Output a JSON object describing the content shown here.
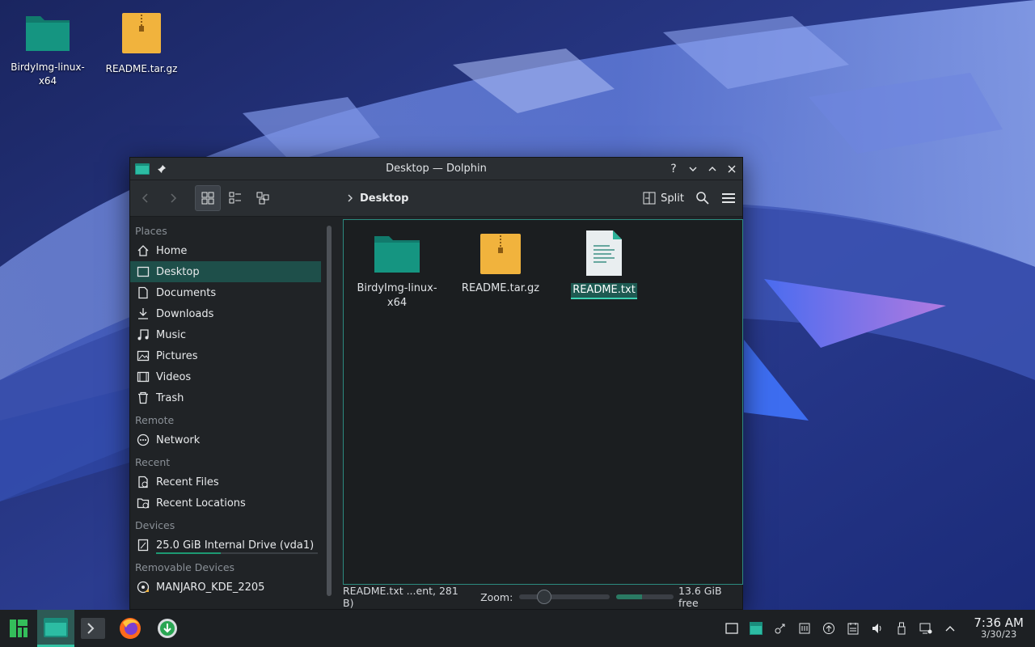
{
  "desktop": {
    "icons": [
      {
        "label": "BirdyImg-linux-x64",
        "type": "folder"
      },
      {
        "label": "README.tar.gz",
        "type": "archive"
      }
    ]
  },
  "window": {
    "title": "Desktop — Dolphin",
    "titlebar_buttons": {
      "help": "?",
      "minimize": "⌄",
      "maximize": "⌃",
      "close": "✕"
    }
  },
  "toolbar": {
    "breadcrumb": "Desktop",
    "split_label": "Split"
  },
  "places": {
    "sections": {
      "places": "Places",
      "remote": "Remote",
      "recent": "Recent",
      "devices": "Devices",
      "removable": "Removable Devices"
    },
    "items": {
      "home": "Home",
      "desktop": "Desktop",
      "documents": "Documents",
      "downloads": "Downloads",
      "music": "Music",
      "pictures": "Pictures",
      "videos": "Videos",
      "trash": "Trash",
      "network": "Network",
      "recent_files": "Recent Files",
      "recent_locations": "Recent Locations",
      "internal_drive": "25.0 GiB Internal Drive (vda1)",
      "manjaro": "MANJARO_KDE_2205"
    },
    "selected": "Desktop",
    "internal_drive_usage": 0.4
  },
  "files": [
    {
      "name": "BirdyImg-linux-x64",
      "type": "folder"
    },
    {
      "name": "README.tar.gz",
      "type": "archive"
    },
    {
      "name": "README.txt",
      "type": "text",
      "selected": true
    }
  ],
  "statusbar": {
    "selection": "README.txt ...ent, 281 B)",
    "zoom_label": "Zoom:",
    "free_space": "13.6 GiB free",
    "used_fraction": 0.45
  },
  "taskbar": {
    "clock_time": "7:36 AM",
    "clock_date": "3/30/23"
  },
  "colors": {
    "accent": "#1d9973",
    "selection": "#1e4f4a",
    "folder": "#1a7a6c",
    "archive": "#f1b33d"
  }
}
